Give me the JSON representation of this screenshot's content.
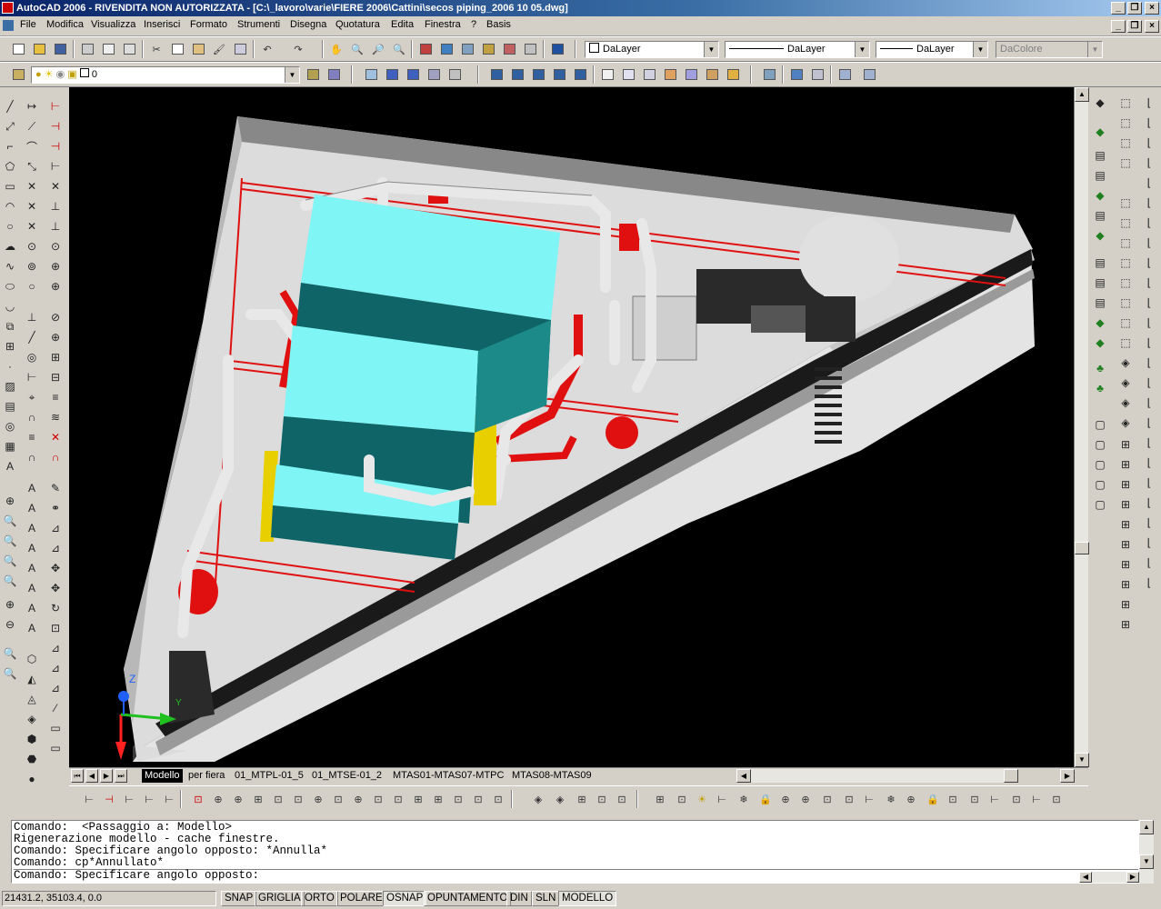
{
  "window": {
    "title": "AutoCAD 2006 - RIVENDITA NON AUTORIZZATA - [C:\\_lavoro\\varie\\FIERE 2006\\Cattini\\secos piping_2006 10 05.dwg]",
    "controls": {
      "minimize": "_",
      "restore": "❐",
      "close": "×"
    }
  },
  "menu": {
    "items": [
      "File",
      "Modifica",
      "Visualizza",
      "Inserisci",
      "Formato",
      "Strumenti",
      "Disegna",
      "Quotatura",
      "Edita",
      "Finestra",
      "?",
      "Basis"
    ]
  },
  "properties": {
    "color": "DaLayer",
    "linetype": "DaLayer",
    "lineweight": "DaLayer",
    "plotstyle": "DaColore"
  },
  "layers": {
    "current": "0"
  },
  "viewport": {
    "background": "#000000",
    "ucs": {
      "z_label": "Z",
      "y_label": "Y"
    }
  },
  "layout_tabs": [
    "Modello",
    "per fiera",
    "01_MTPL-01_5",
    "01_MTSE-01_2",
    "MTAS01-MTAS07-MTPC",
    "MTAS08-MTAS09"
  ],
  "active_tab": "Modello",
  "command": {
    "lines": [
      "Comando:  <Passaggio a: Modello>",
      "Rigenerazione modello - cache finestre.",
      "Comando: Specificare angolo opposto: *Annulla*",
      "Comando: cp*Annullato*",
      "Comando: Specificare angolo opposto:"
    ]
  },
  "status": {
    "coordinates": "21431.2, 35103.4, 0.0",
    "toggles": [
      "SNAP",
      "GRIGLIA",
      "ORTO",
      "POLARE",
      "OSNAP",
      "OPUNTAMENTO",
      "DIN",
      "SLN",
      "MODELLO"
    ],
    "active_toggles": [
      "OSNAP",
      "MODELLO"
    ]
  },
  "colors": {
    "titlebar": "#0a246a",
    "chrome": "#d4d0c8",
    "model_cyan": "#7ff5f5",
    "model_teal": "#0e6466",
    "model_red": "#e01010",
    "model_grey": "#d6d6d6"
  }
}
